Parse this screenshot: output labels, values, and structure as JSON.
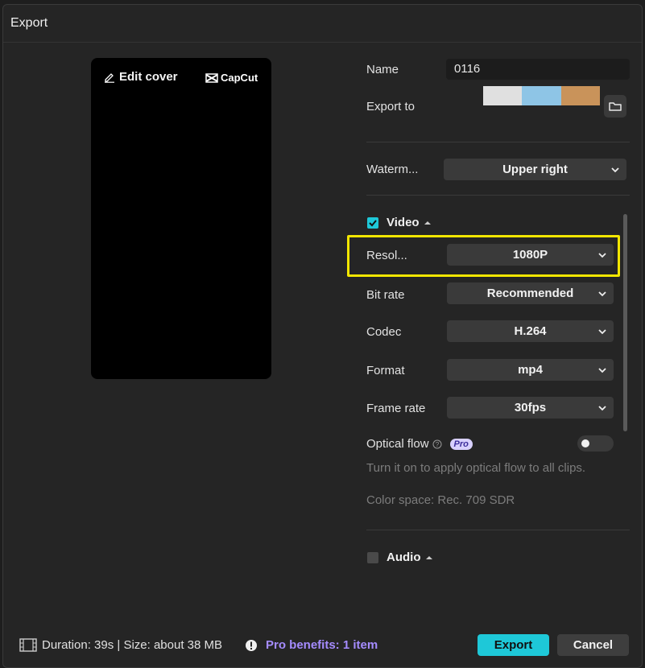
{
  "dialog": {
    "title": "Export"
  },
  "preview": {
    "edit_cover_label": "Edit cover",
    "brand_logo": "CapCut"
  },
  "name": {
    "label": "Name",
    "value": "0116"
  },
  "export_to": {
    "label": "Export to",
    "path_colors": [
      "#e0e0e0",
      "#8ec5e6",
      "#c9935a"
    ],
    "folder_icon": "folder-icon"
  },
  "watermark": {
    "label": "Waterm...",
    "value": "Upper right"
  },
  "video": {
    "label": "Video",
    "checked": true,
    "resolution": {
      "label": "Resol...",
      "value": "1080P"
    },
    "bit_rate": {
      "label": "Bit rate",
      "value": "Recommended"
    },
    "codec": {
      "label": "Codec",
      "value": "H.264"
    },
    "format": {
      "label": "Format",
      "value": "mp4"
    },
    "frame_rate": {
      "label": "Frame rate",
      "value": "30fps"
    },
    "optical_flow": {
      "label": "Optical flow",
      "badge": "Pro",
      "enabled": false,
      "hint": "Turn it on to apply optical flow to all clips."
    },
    "color_space": "Color space: Rec. 709 SDR"
  },
  "audio": {
    "label": "Audio",
    "checked": false
  },
  "footer": {
    "duration_size": "Duration: 39s | Size: about 38 MB",
    "pro_benefits": "Pro benefits: 1 item",
    "export_label": "Export",
    "cancel_label": "Cancel"
  },
  "colors": {
    "accent": "#1ec8d8",
    "highlight": "#f2e600",
    "pro": "#a58cff"
  }
}
